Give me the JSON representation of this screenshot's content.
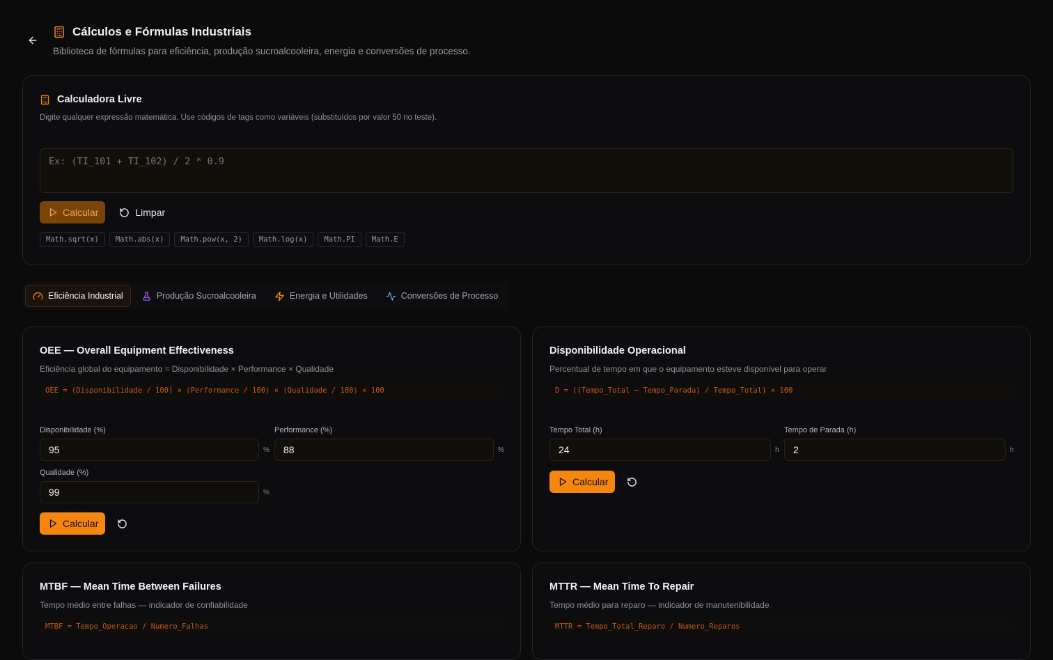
{
  "header": {
    "title": "Cálculos e Fórmulas Industriais",
    "subtitle": "Biblioteca de fórmulas para eficiência, produção sucroalcooleira, energia e conversões de processo."
  },
  "calculator": {
    "title": "Calculadora Livre",
    "description": "Digite qualquer expressão matemática. Use códigos de tags como variáveis (substituídos por valor 50 no teste).",
    "placeholder": "Ex: (TI_101 + TI_102) / 2 * 0.9",
    "calc_label": "Calcular",
    "clear_label": "Limpar",
    "chips": [
      "Math.sqrt(x)",
      "Math.abs(x)",
      "Math.pow(x, 2)",
      "Math.log(x)",
      "Math.PI",
      "Math.E"
    ]
  },
  "tabs": [
    {
      "label": "Eficiência Industrial",
      "icon": "gauge-icon",
      "active": true
    },
    {
      "label": "Produção Sucroalcooleira",
      "icon": "flask-icon",
      "active": false
    },
    {
      "label": "Energia e Utilidades",
      "icon": "zap-icon",
      "active": false
    },
    {
      "label": "Conversões de Processo",
      "icon": "activity-icon",
      "active": false
    }
  ],
  "colors": {
    "accent": "#f5860f",
    "formula": "#c2581c",
    "flask": "#a855f7",
    "zap": "#f59e0b",
    "activity": "#60a5fa"
  },
  "cards": {
    "oee": {
      "title": "OEE — Overall Equipment Effectiveness",
      "description": "Eficiência global do equipamento = Disponibilidade × Performance × Qualidade",
      "formula": "OEE = (Disponibilidade / 100) × (Performance / 100) × (Qualidade / 100) × 100",
      "fields": [
        {
          "label": "Disponibilidade (%)",
          "value": "95",
          "unit": "%"
        },
        {
          "label": "Performance (%)",
          "value": "88",
          "unit": "%"
        },
        {
          "label": "Qualidade (%)",
          "value": "99",
          "unit": "%"
        }
      ],
      "calc_label": "Calcular"
    },
    "disponibilidade": {
      "title": "Disponibilidade Operacional",
      "description": "Percentual de tempo em que o equipamento esteve disponível para operar",
      "formula": "D = ((Tempo_Total − Tempo_Parada) / Tempo_Total) × 100",
      "fields": [
        {
          "label": "Tempo Total (h)",
          "value": "24",
          "unit": "h"
        },
        {
          "label": "Tempo de Parada (h)",
          "value": "2",
          "unit": "h"
        }
      ],
      "calc_label": "Calcular"
    },
    "mtbf": {
      "title": "MTBF — Mean Time Between Failures",
      "description": "Tempo médio entre falhas — indicador de confiabilidade",
      "formula": "MTBF = Tempo_Operacao / Numero_Falhas"
    },
    "mttr": {
      "title": "MTTR — Mean Time To Repair",
      "description": "Tempo médio para reparo — indicador de manutenibilidade",
      "formula": "MTTR = Tempo_Total_Reparo / Numero_Reparos"
    }
  }
}
